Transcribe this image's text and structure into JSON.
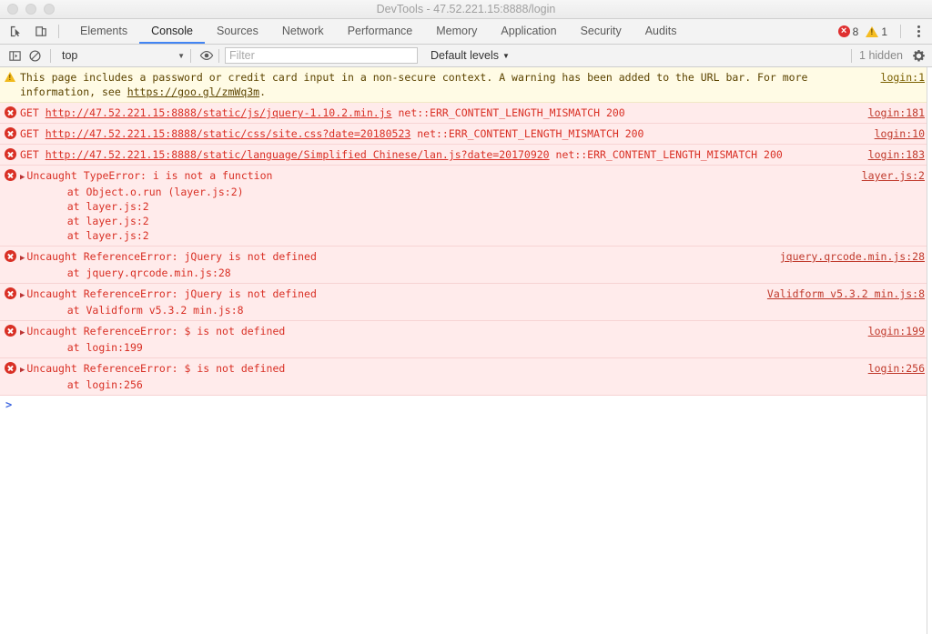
{
  "window": {
    "title": "DevTools - 47.52.221.15:8888/login",
    "traffic_lights": [
      "close",
      "minimize",
      "zoom"
    ]
  },
  "tabbar": {
    "inspect_icon": "inspect-element-icon",
    "device_icon": "device-toolbar-icon",
    "tabs": [
      {
        "label": "Elements",
        "active": false
      },
      {
        "label": "Console",
        "active": true
      },
      {
        "label": "Sources",
        "active": false
      },
      {
        "label": "Network",
        "active": false
      },
      {
        "label": "Performance",
        "active": false
      },
      {
        "label": "Memory",
        "active": false
      },
      {
        "label": "Application",
        "active": false
      },
      {
        "label": "Security",
        "active": false
      },
      {
        "label": "Audits",
        "active": false
      }
    ],
    "error_count": "8",
    "warning_count": "1",
    "menu_icon": "kebab-menu-icon",
    "error_color": "#d93025",
    "warning_color": "#f1b91b",
    "active_tab_color": "#4285f4"
  },
  "filterbar": {
    "sidebar_toggle_icon": "console-sidebar-icon",
    "clear_icon": "clear-console-icon",
    "context": "top",
    "context_caret": "▼",
    "eye_icon": "live-expression-icon",
    "filter_placeholder": "Filter",
    "filter_value": "",
    "levels_label": "Default levels",
    "levels_caret": "▼",
    "hidden_label": "1 hidden",
    "settings_icon": "gear-icon"
  },
  "console": {
    "messages": [
      {
        "type": "warning",
        "icon": "warning-triangle-icon",
        "text": "This page includes a password or credit card input in a non-secure context. A warning has been added to the URL bar. For more information, see ",
        "link": "https://goo.gl/zmWq3m",
        "text_after": ".",
        "source": "login:1"
      },
      {
        "type": "error",
        "icon": "error-circle-icon",
        "method": "GET",
        "url": "http://47.52.221.15:8888/static/js/jquery-1.10.2.min.js",
        "status": "net::ERR_CONTENT_LENGTH_MISMATCH 200",
        "source": "login:181"
      },
      {
        "type": "error",
        "icon": "error-circle-icon",
        "method": "GET",
        "url": "http://47.52.221.15:8888/static/css/site.css?date=20180523",
        "status": "net::ERR_CONTENT_LENGTH_MISMATCH 200",
        "source": "login:10"
      },
      {
        "type": "error",
        "icon": "error-circle-icon",
        "method": "GET",
        "url": "http://47.52.221.15:8888/static/language/Simplified Chinese/lan.js?date=20170920",
        "status": "net::ERR_CONTENT_LENGTH_MISMATCH 200",
        "source": "login:183"
      },
      {
        "type": "error",
        "icon": "error-circle-icon",
        "expander": "▶",
        "text": "Uncaught TypeError: i is not a function",
        "stack": [
          "    at Object.o.run (layer.js:2)",
          "    at layer.js:2",
          "    at layer.js:2",
          "    at layer.js:2"
        ],
        "source": "layer.js:2"
      },
      {
        "type": "error",
        "icon": "error-circle-icon",
        "expander": "▶",
        "text": "Uncaught ReferenceError: jQuery is not defined",
        "stack": [
          "    at jquery.qrcode.min.js:28"
        ],
        "source": "jquery.qrcode.min.js:28"
      },
      {
        "type": "error",
        "icon": "error-circle-icon",
        "expander": "▶",
        "text": "Uncaught ReferenceError: jQuery is not defined",
        "stack": [
          "    at Validform v5.3.2 min.js:8"
        ],
        "source": "Validform v5.3.2 min.js:8"
      },
      {
        "type": "error",
        "icon": "error-circle-icon",
        "expander": "▶",
        "text": "Uncaught ReferenceError: $ is not defined",
        "stack": [
          "    at login:199"
        ],
        "source": "login:199"
      },
      {
        "type": "error",
        "icon": "error-circle-icon",
        "expander": "▶",
        "text": "Uncaught ReferenceError: $ is not defined",
        "stack": [
          "    at login:256"
        ],
        "source": "login:256"
      }
    ],
    "prompt": ">"
  }
}
